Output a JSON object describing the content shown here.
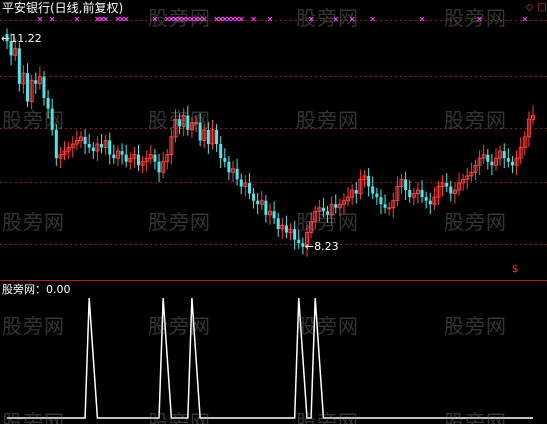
{
  "title": "平安银行(日线,前复权)",
  "indicator": {
    "name": "股旁网",
    "value": "0.00",
    "label": "股旁网：0.00"
  },
  "watermark": "股旁网",
  "annotations": {
    "high": "11.22",
    "low": "8.23"
  },
  "window_buttons": {
    "restore_icon": "◇",
    "maximize_icon": "□"
  },
  "signal_symbol": "$",
  "colors": {
    "background": "#000000",
    "up_candle": "#ff3c3c",
    "down_candle": "#4fe8e8",
    "grid": "#8b1a1a",
    "marker": "#ff40ff",
    "indicator_line": "#ffffff"
  },
  "chart_data": [
    {
      "type": "candlestick",
      "title": "平安银行(日线,前复权)",
      "high_label": 11.22,
      "low_label": 8.23,
      "ylim": [
        7.95,
        11.45
      ],
      "grid": true,
      "series": [
        {
          "name": "close",
          "values": [
            11.15,
            10.95,
            11.05,
            10.55,
            10.7,
            10.3,
            10.6,
            10.55,
            10.65,
            10.35,
            10.2,
            9.9,
            9.5,
            9.55,
            9.6,
            9.65,
            9.7,
            9.75,
            9.8,
            9.7,
            9.65,
            9.6,
            9.7,
            9.65,
            9.75,
            9.55,
            9.5,
            9.6,
            9.55,
            9.45,
            9.5,
            9.55,
            9.4,
            9.45,
            9.5,
            9.55,
            9.45,
            9.3,
            9.45,
            9.55,
            9.8,
            10.05,
            9.95,
            10.1,
            9.9,
            10.0,
            10.0,
            9.75,
            9.9,
            9.7,
            9.9,
            9.7,
            9.5,
            9.45,
            9.3,
            9.35,
            9.2,
            9.1,
            9.15,
            9.0,
            8.9,
            8.85,
            8.9,
            8.7,
            8.75,
            8.65,
            8.5,
            8.55,
            8.45,
            8.5,
            8.35,
            8.3,
            8.25,
            8.45,
            8.6,
            8.75,
            8.8,
            8.75,
            8.7,
            8.85,
            8.8,
            8.85,
            8.9,
            8.95,
            9.05,
            9.0,
            9.2,
            9.25,
            9.1,
            9.0,
            8.95,
            8.85,
            8.8,
            8.8,
            8.9,
            9.1,
            9.2,
            9.05,
            8.95,
            9.0,
            9.05,
            8.95,
            8.9,
            8.85,
            8.95,
            9.1,
            9.15,
            9.1,
            9.0,
            9.05,
            9.15,
            9.2,
            9.25,
            9.3,
            9.4,
            9.5,
            9.55,
            9.45,
            9.4,
            9.5,
            9.6,
            9.5,
            9.45,
            9.4,
            9.5,
            9.65,
            9.8,
            10.05,
            10.1
          ]
        }
      ],
      "signal_markers": [
        8,
        11,
        17,
        22,
        23,
        24,
        27,
        28,
        29,
        36,
        39,
        40,
        41,
        42,
        43,
        44,
        45,
        46,
        47,
        48,
        51,
        52,
        53,
        54,
        55,
        56,
        57,
        60,
        64,
        74,
        80,
        84,
        89,
        101,
        115,
        126
      ]
    },
    {
      "type": "line",
      "title": "股旁网",
      "value_label": 0.0,
      "ylim": [
        0,
        1
      ],
      "series": [
        {
          "name": "股旁网",
          "spikes": [
            {
              "start": 19,
              "peak": 20,
              "end": 22
            },
            {
              "start": 37,
              "peak": 38,
              "end": 40
            },
            {
              "start": 44,
              "peak": 45,
              "end": 47
            },
            {
              "start": 70,
              "peak": 71,
              "end": 73
            },
            {
              "start": 74,
              "peak": 75,
              "end": 77
            }
          ]
        }
      ]
    }
  ]
}
